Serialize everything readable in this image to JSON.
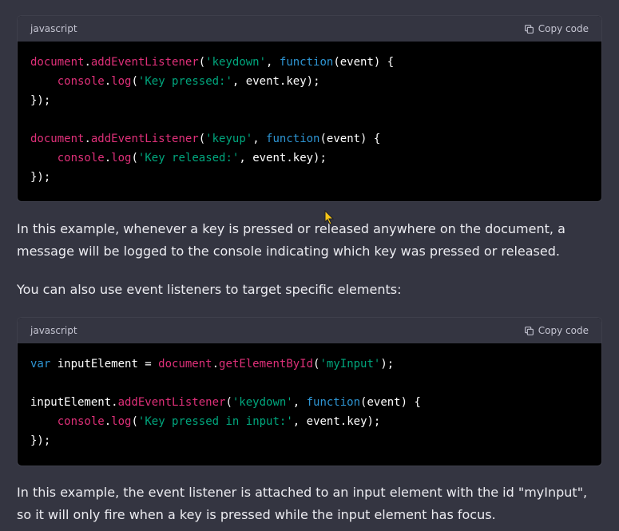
{
  "code_blocks": [
    {
      "language": "javascript",
      "copy_label": "Copy code",
      "lines": [
        [
          [
            "o",
            "document"
          ],
          [
            "p",
            "."
          ],
          [
            "o",
            "addEventListener"
          ],
          [
            "p",
            "("
          ],
          [
            "s",
            "'keydown'"
          ],
          [
            "p",
            ", "
          ],
          [
            "k",
            "function"
          ],
          [
            "p",
            "(event) {"
          ]
        ],
        [
          [
            "p",
            "    "
          ],
          [
            "o",
            "console"
          ],
          [
            "p",
            "."
          ],
          [
            "o",
            "log"
          ],
          [
            "p",
            "("
          ],
          [
            "s",
            "'Key pressed:'"
          ],
          [
            "p",
            ", event.key);"
          ]
        ],
        [
          [
            "p",
            "});"
          ]
        ],
        [
          [
            "p",
            ""
          ]
        ],
        [
          [
            "o",
            "document"
          ],
          [
            "p",
            "."
          ],
          [
            "o",
            "addEventListener"
          ],
          [
            "p",
            "("
          ],
          [
            "s",
            "'keyup'"
          ],
          [
            "p",
            ", "
          ],
          [
            "k",
            "function"
          ],
          [
            "p",
            "(event) {"
          ]
        ],
        [
          [
            "p",
            "    "
          ],
          [
            "o",
            "console"
          ],
          [
            "p",
            "."
          ],
          [
            "o",
            "log"
          ],
          [
            "p",
            "("
          ],
          [
            "s",
            "'Key released:'"
          ],
          [
            "p",
            ", event.key);"
          ]
        ],
        [
          [
            "p",
            "});"
          ]
        ]
      ]
    },
    {
      "language": "javascript",
      "copy_label": "Copy code",
      "lines": [
        [
          [
            "k",
            "var"
          ],
          [
            "p",
            " inputElement = "
          ],
          [
            "o",
            "document"
          ],
          [
            "p",
            "."
          ],
          [
            "o",
            "getElementById"
          ],
          [
            "p",
            "("
          ],
          [
            "s",
            "'myInput'"
          ],
          [
            "p",
            ");"
          ]
        ],
        [
          [
            "p",
            ""
          ]
        ],
        [
          [
            "p",
            "inputElement."
          ],
          [
            "o",
            "addEventListener"
          ],
          [
            "p",
            "("
          ],
          [
            "s",
            "'keydown'"
          ],
          [
            "p",
            ", "
          ],
          [
            "k",
            "function"
          ],
          [
            "p",
            "(event) {"
          ]
        ],
        [
          [
            "p",
            "    "
          ],
          [
            "o",
            "console"
          ],
          [
            "p",
            "."
          ],
          [
            "o",
            "log"
          ],
          [
            "p",
            "("
          ],
          [
            "s",
            "'Key pressed in input:'"
          ],
          [
            "p",
            ", event.key);"
          ]
        ],
        [
          [
            "p",
            "});"
          ]
        ]
      ]
    }
  ],
  "paragraphs": {
    "p1": "In this example, whenever a key is pressed or released anywhere on the document, a message will be logged to the console indicating which key was pressed or released.",
    "p2": "You can also use event listeners to target specific elements:",
    "p3": "In this example, the event listener is attached to an input element with the id \"myInput\", so it will only fire when a key is pressed while the input element has focus."
  },
  "colors": {
    "background": "#343541",
    "code_background": "#000000",
    "keyword": "#2e95d3",
    "method": "#df3079",
    "string": "#00a67d"
  },
  "icons": [
    "copy-icon",
    "mouse-cursor-icon"
  ]
}
